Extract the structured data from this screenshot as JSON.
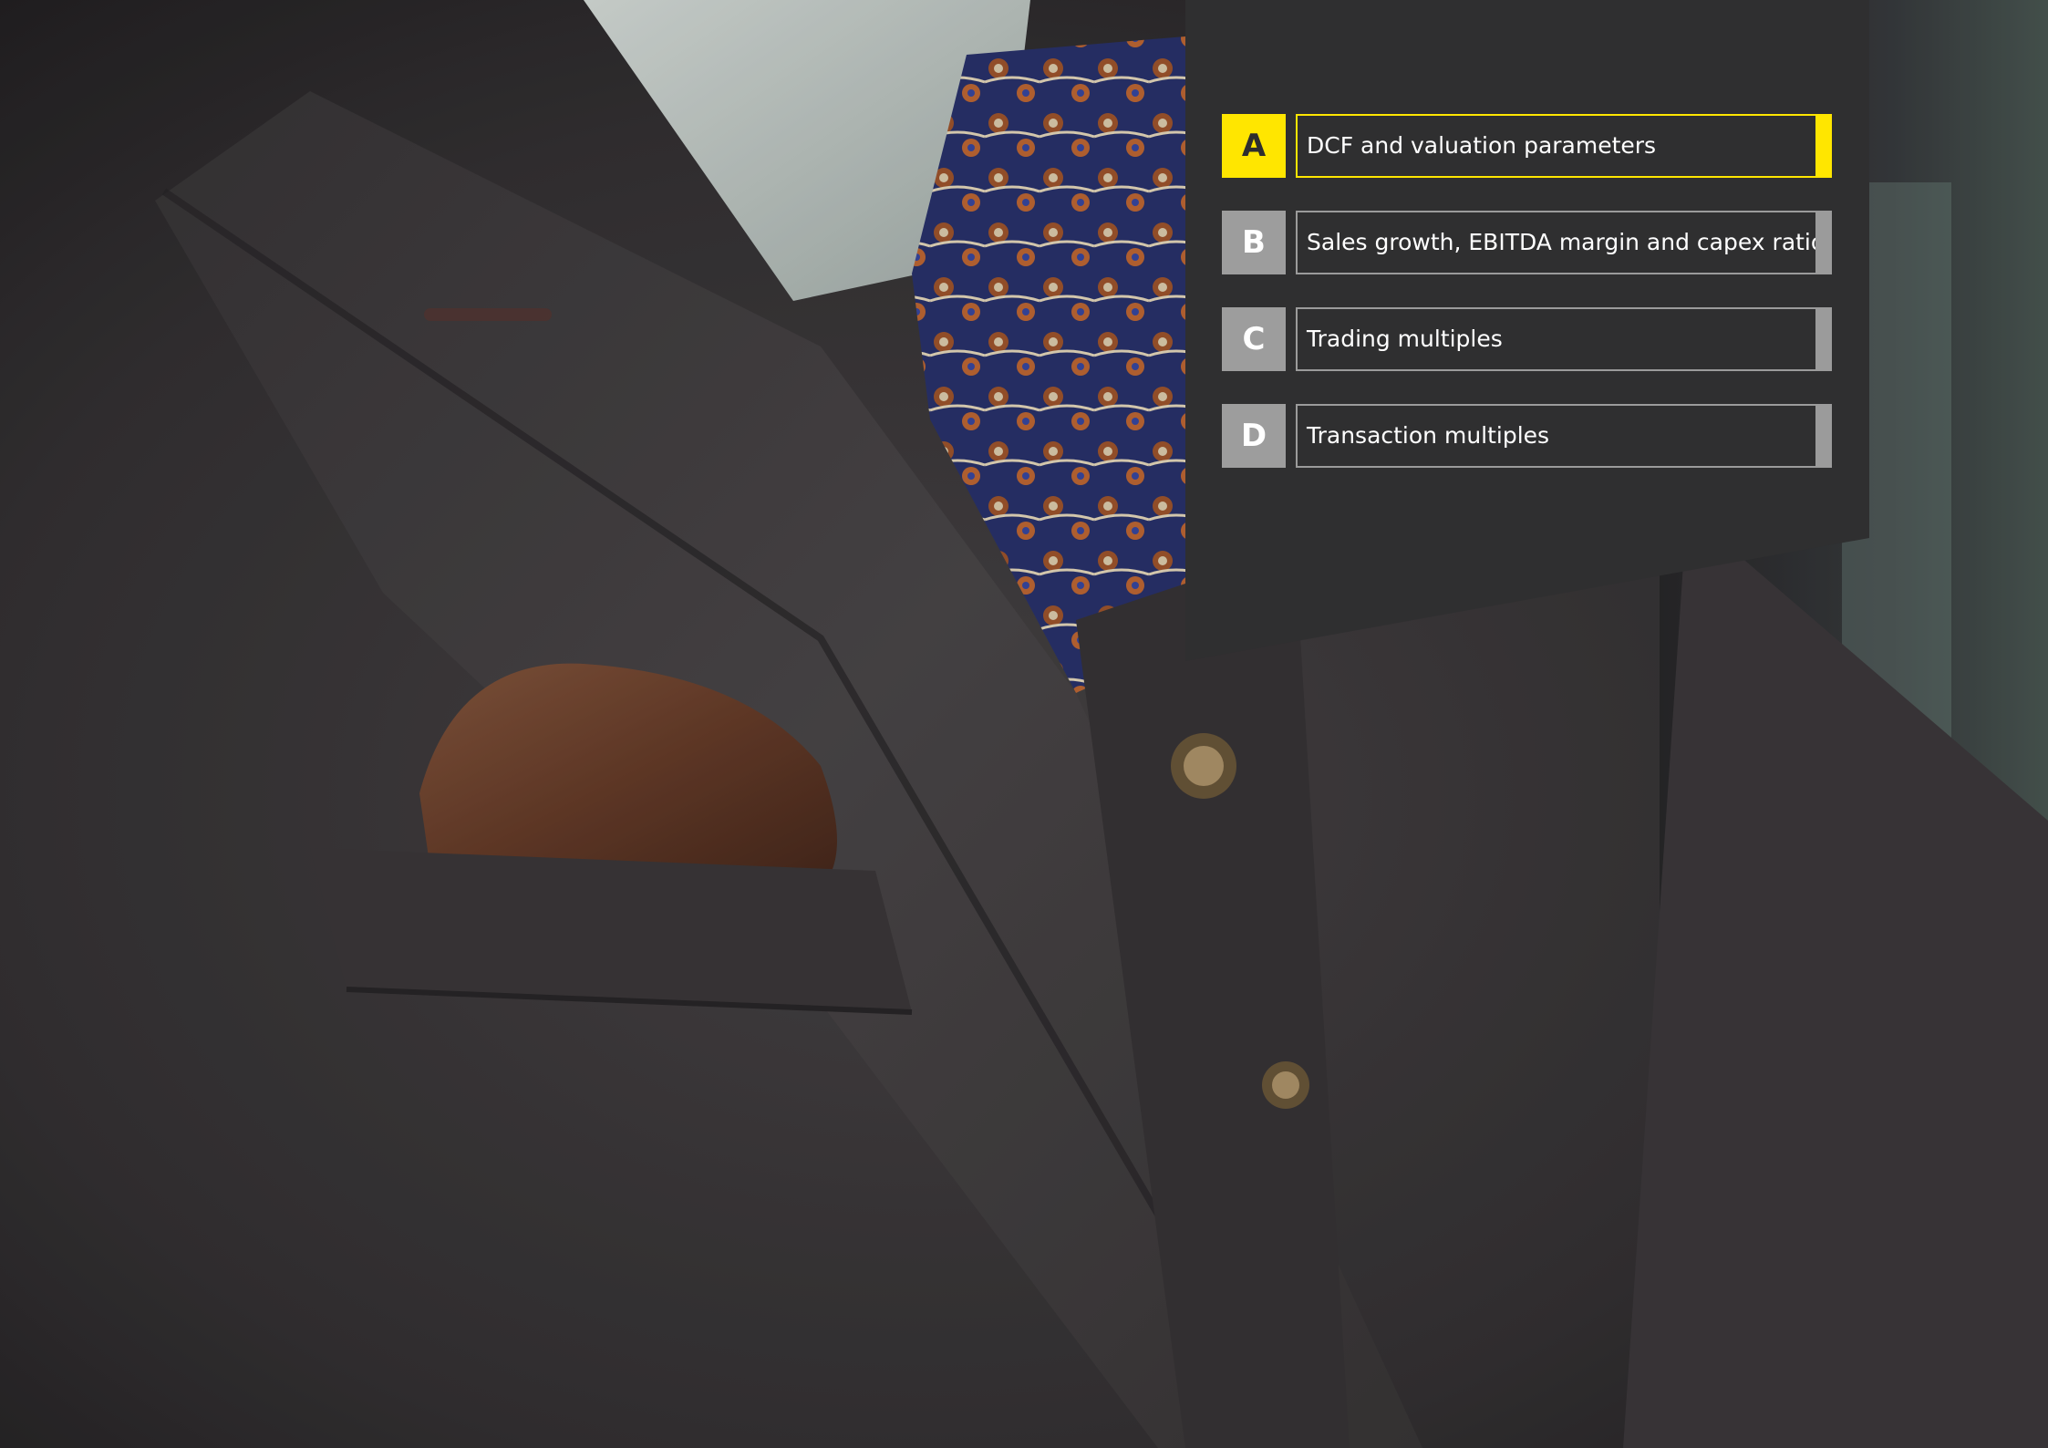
{
  "colors": {
    "accent": "#ffe600",
    "inactive": "#9d9d9d",
    "panel": "#2f2f30",
    "text": "#ffffff"
  },
  "menu": {
    "items": [
      {
        "letter": "A",
        "label": "DCF and valuation parameters",
        "active": true
      },
      {
        "letter": "B",
        "label": "Sales growth, EBITDA margin and capex ratio",
        "active": false
      },
      {
        "letter": "C",
        "label": "Trading multiples",
        "active": false
      },
      {
        "letter": "D",
        "label": "Transaction multiples",
        "active": false
      }
    ]
  }
}
